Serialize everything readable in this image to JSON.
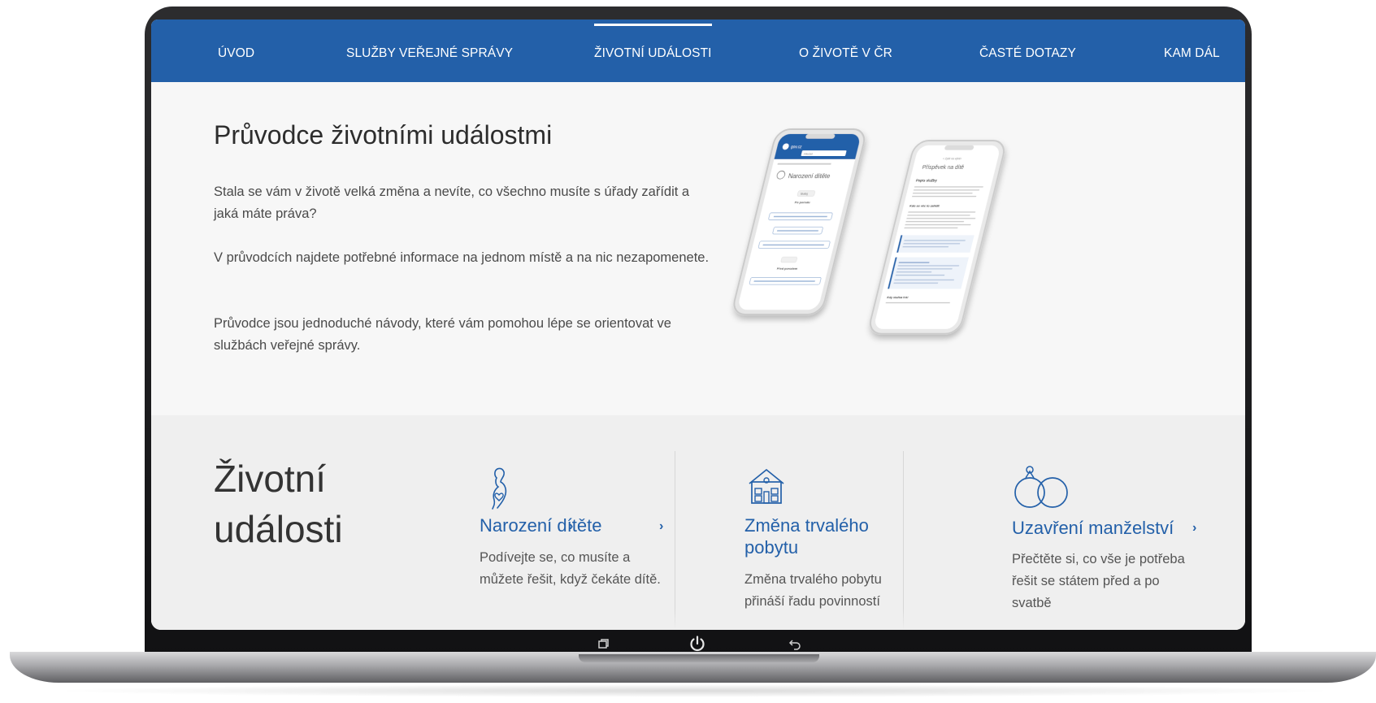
{
  "nav": {
    "items": [
      {
        "label": "ÚVOD"
      },
      {
        "label": "SLUŽBY VEŘEJNÉ SPRÁVY"
      },
      {
        "label": "ŽIVOTNÍ UDÁLOSTI",
        "active": true
      },
      {
        "label": "O ŽIVOTĚ V ČR"
      },
      {
        "label": "ČASTÉ DOTAZY"
      },
      {
        "label": "KAM DÁL"
      }
    ]
  },
  "hero": {
    "title": "Průvodce životními událostmi",
    "paragraphs": [
      "Stala se vám v životě velká změna a nevíte, co všechno musíte s úřady zařídit a jaká máte práva?",
      "V průvodcích najdete potřebné informace na jednom místě a na nic nezapomenete.",
      "Průvodce jsou jednoduché návody, které vám pomohou lépe se orientovat ve službách veřejné správy."
    ],
    "phone_left": {
      "brand": "gov.cz",
      "search_placeholder": "Hledat",
      "page_title": "Narození dítěte",
      "step1": "Buduj",
      "step2": "Po porodu",
      "step3": "Před porodem"
    },
    "phone_right": {
      "back": "< Zpět na výběr",
      "title": "Příspěvek na dítě",
      "section1": "Popis služby",
      "section2": "Kdo se věc to zařídit",
      "section3": "Kdy služba řeší"
    }
  },
  "events": {
    "title_line1": "Životní",
    "title_line2": "události",
    "cards": [
      {
        "icon": "pregnant-woman-icon",
        "title": "Narození dítěte",
        "text_lines": [
          "Podívejte se, co musíte a",
          "můžete řešit, když čekáte dítě."
        ]
      },
      {
        "icon": "house-icon",
        "title_lines": [
          "Změna trvalého",
          "pobytu"
        ],
        "text_lines": [
          "Změna trvalého pobytu",
          "přináší řadu povinností"
        ]
      },
      {
        "icon": "wedding-rings-icon",
        "title": "Uzavření manželství",
        "text_lines": [
          "Přečtěte si, co vše je potřeba",
          "řešit se státem před a po",
          "svatbě"
        ]
      }
    ]
  },
  "device": {
    "bottom_bar": [
      "recent-apps-icon",
      "power-icon",
      "back-arrow-icon"
    ]
  },
  "colors": {
    "brand_blue": "#2360a9",
    "nav_text": "#ffffff",
    "page_background": "#f5f5f5"
  }
}
